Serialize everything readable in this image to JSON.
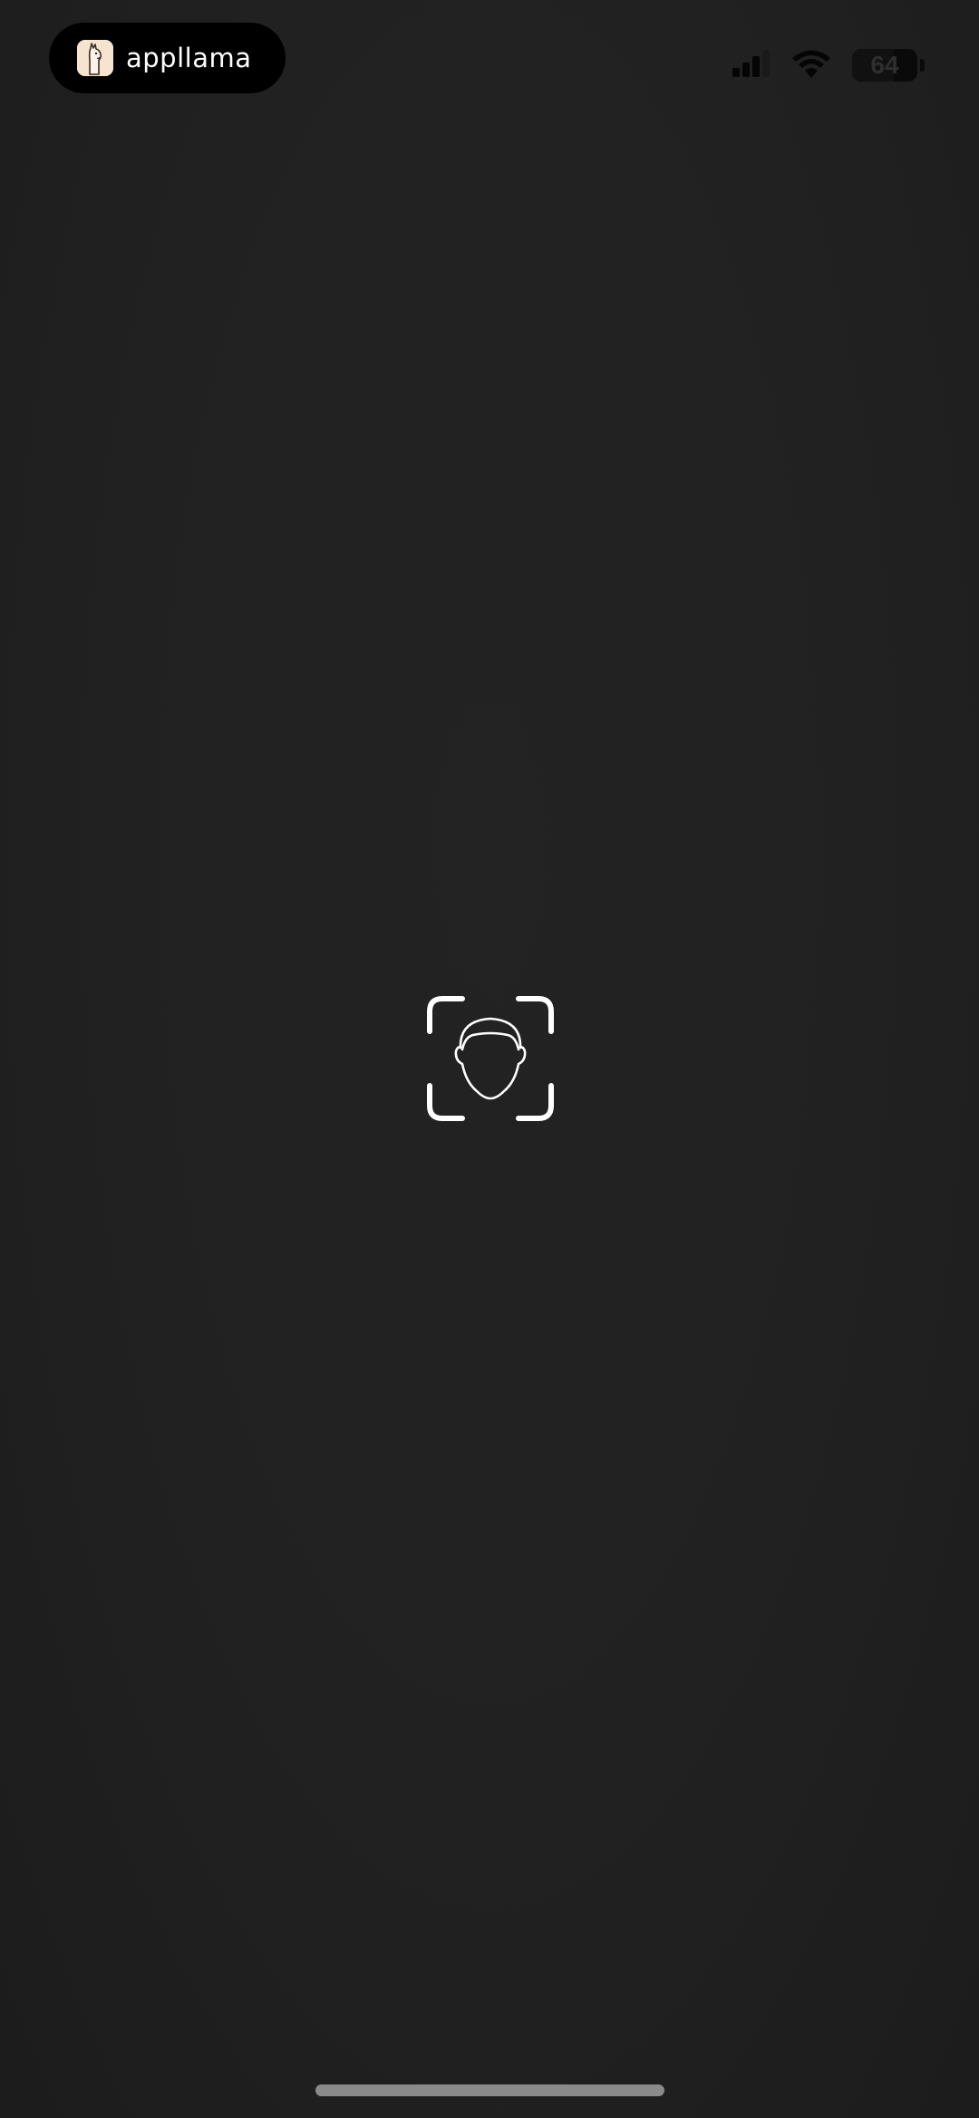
{
  "app_pill": {
    "app_name": "appllama",
    "icon": "llama-app-icon"
  },
  "status_bar": {
    "signal_icon": "cellular-signal-icon",
    "wifi_icon": "wifi-icon",
    "battery_level": "64",
    "battery_fraction": 0.64
  },
  "main": {
    "icon": "face-id-icon"
  },
  "colors": {
    "background": "#212121",
    "pill": "#000000",
    "icon_stroke": "#ffffff",
    "home_indicator": "#8a8a8a"
  }
}
